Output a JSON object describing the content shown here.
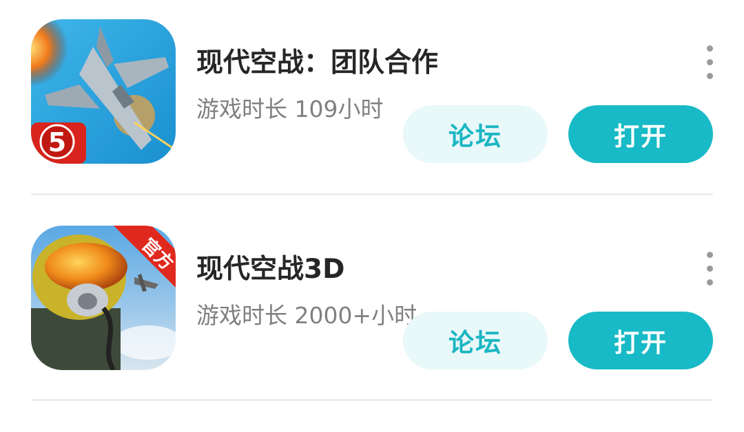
{
  "games": [
    {
      "title": "现代空战：团队合作",
      "play_time": "游戏时长 109小时",
      "icon": "modern-combat-jet-icon",
      "icon_badge": "5",
      "forum_label": "论坛",
      "open_label": "打开"
    },
    {
      "title": "现代空战3D",
      "play_time": "游戏时长 2000+小时",
      "icon": "pilot-helmet-icon",
      "icon_badge": "官方",
      "forum_label": "论坛",
      "open_label": "打开"
    }
  ],
  "colors": {
    "accent": "#17bac6",
    "forum_bg": "#e9f8f9",
    "title_text": "#262626",
    "subtitle_text": "#808080",
    "divider": "#ececec"
  }
}
